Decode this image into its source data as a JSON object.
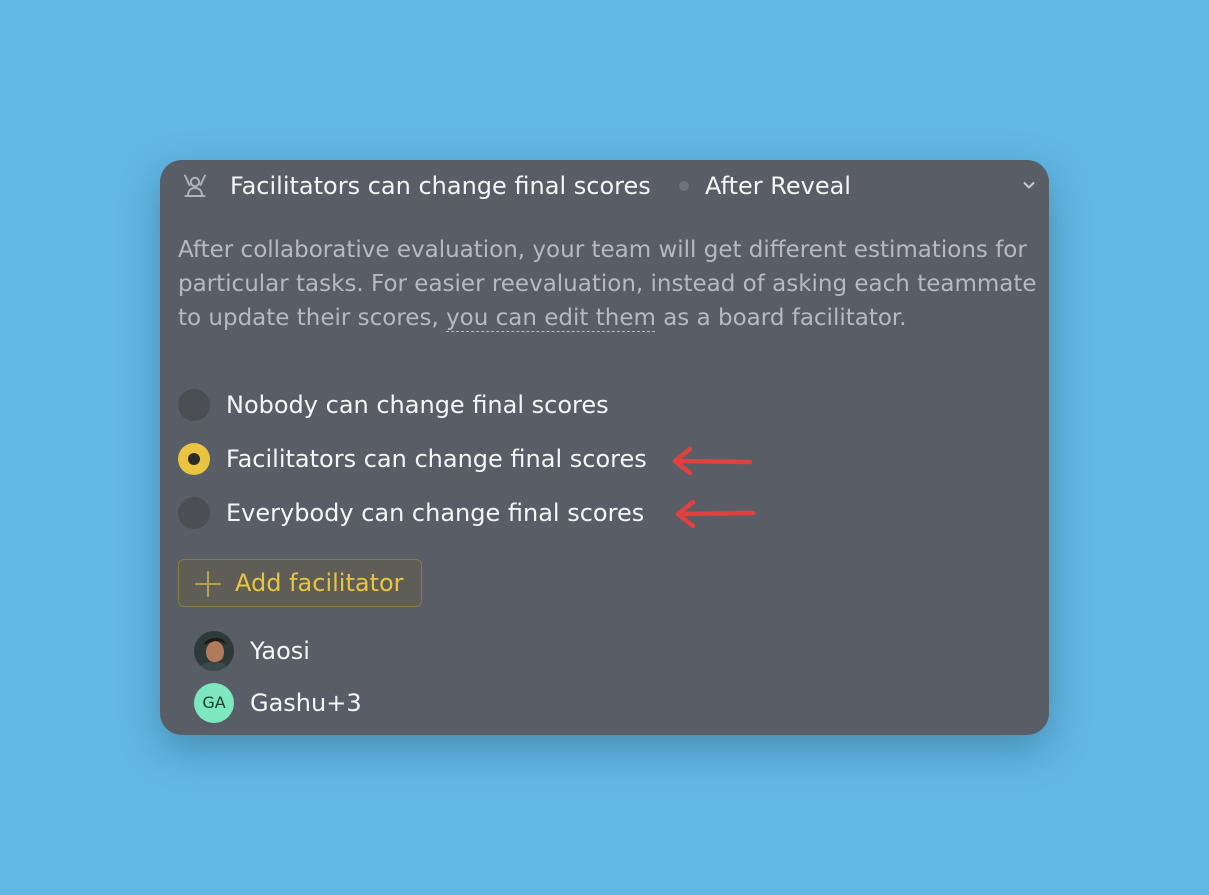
{
  "setting": {
    "title": "Facilitators can change final scores",
    "timing": "After Reveal",
    "icon": "facilitator-icon",
    "description": {
      "before_link": "After collaborative evaluation, your team will get different estimations for particular tasks. For easier reevaluation, instead of asking each teammate to update their scores, ",
      "link": "you can edit them",
      "after_link": " as a board facilitator."
    },
    "options": [
      {
        "label": "Nobody can change final scores",
        "selected": false
      },
      {
        "label": "Facilitators can change final scores",
        "selected": true
      },
      {
        "label": "Everybody can change final scores",
        "selected": false
      }
    ],
    "add_button": {
      "label": "Add facilitator",
      "icon": "plus-icon"
    },
    "facilitators": [
      {
        "name": "Yaosi",
        "avatar": "photo"
      },
      {
        "name": "Gashu+3",
        "initials": "GA"
      }
    ]
  },
  "colors": {
    "background": "#62b8e4",
    "panel": "#595e66",
    "accent": "#e9c441",
    "annotation_arrow": "#e0403f",
    "initials_avatar": "#7de8bf"
  }
}
